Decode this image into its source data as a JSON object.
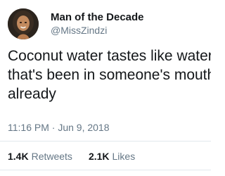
{
  "tweet": {
    "author": {
      "display_name": "Man of the Decade",
      "handle": "@MissZindzi"
    },
    "text": "Coconut water tastes like water\nthat's been in someone's mouth\nalready",
    "timestamp": "11:16 PM · Jun 9, 2018",
    "stats": {
      "retweets_count": "1.4K",
      "retweets_label": "Retweets",
      "likes_count": "2.1K",
      "likes_label": "Likes"
    }
  }
}
